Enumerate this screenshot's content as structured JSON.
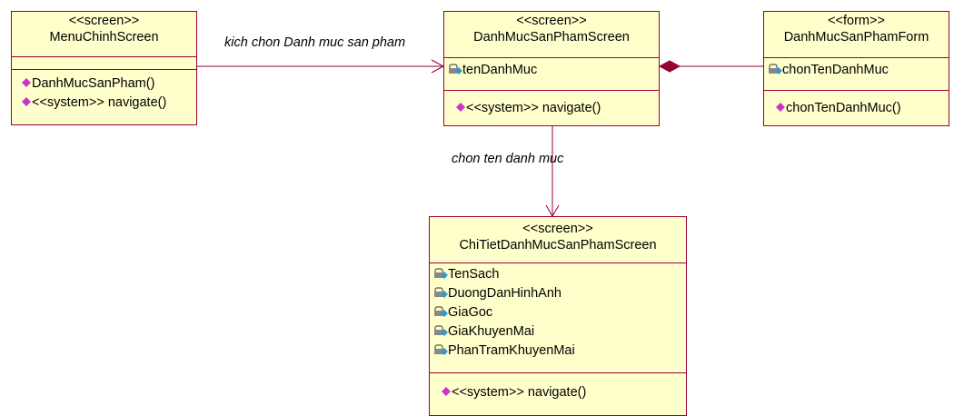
{
  "diagram": {
    "classes": {
      "menu": {
        "stereotype": "<<screen>>",
        "name": "MenuChinhScreen",
        "attributes": [],
        "operations": [
          "DanhMucSanPham()",
          "<<system>> navigate()"
        ]
      },
      "danhmuc": {
        "stereotype": "<<screen>>",
        "name": "DanhMucSanPhamScreen",
        "attributes": [
          "tenDanhMuc"
        ],
        "operations": [
          "<<system>> navigate()"
        ]
      },
      "form": {
        "stereotype": "<<form>>",
        "name": "DanhMucSanPhamForm",
        "attributes": [
          "chonTenDanhMuc"
        ],
        "operations": [
          "chonTenDanhMuc()"
        ]
      },
      "chitiet": {
        "stereotype": "<<screen>>",
        "name": "ChiTietDanhMucSanPhamScreen",
        "attributes": [
          "TenSach",
          "DuongDanHinhAnh",
          "GiaGoc",
          "GiaKhuyenMai",
          "PhanTramKhuyenMai"
        ],
        "operations": [
          "<<system>> navigate()"
        ]
      }
    },
    "edges": {
      "menu_to_danhmuc": "kich chon Danh muc san pham",
      "danhmuc_to_chitiet": "chon ten danh muc"
    },
    "colors": {
      "box_fill": "#ffffcc",
      "border": "#990033",
      "operation_icon": "#cc33cc",
      "attribute_icon": "#3399cc"
    }
  }
}
